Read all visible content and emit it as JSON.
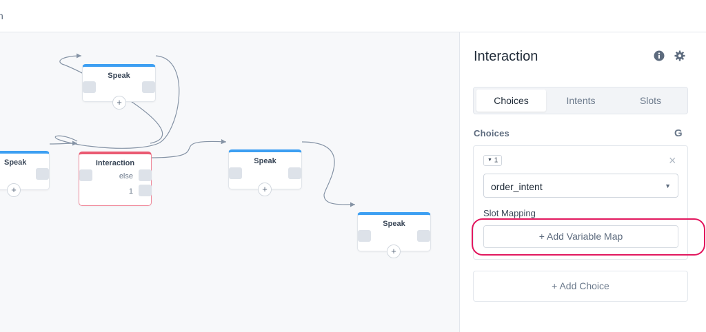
{
  "topbar": {
    "fragment": "n"
  },
  "canvas": {
    "blocks": [
      {
        "title": "Speak"
      },
      {
        "title": "Speak"
      },
      {
        "title": "Interaction",
        "ports": [
          "else",
          "1"
        ]
      },
      {
        "title": "Speak"
      },
      {
        "title": "Speak"
      }
    ],
    "add_glyph": "+"
  },
  "panel": {
    "title": "Interaction",
    "tabs": [
      "Choices",
      "Intents",
      "Slots"
    ],
    "active_tab": "Choices",
    "section_label": "Choices",
    "section_icon": "G",
    "choice": {
      "number": "1",
      "intent": "order_intent",
      "slot_mapping_label": "Slot Mapping",
      "add_variable_label": "+ Add Variable Map"
    },
    "add_choice_label": "+  Add Choice"
  },
  "colors": {
    "accent_blue": "#3d9ff2",
    "interaction_red": "#ea5a72",
    "highlight": "#e2175e"
  }
}
